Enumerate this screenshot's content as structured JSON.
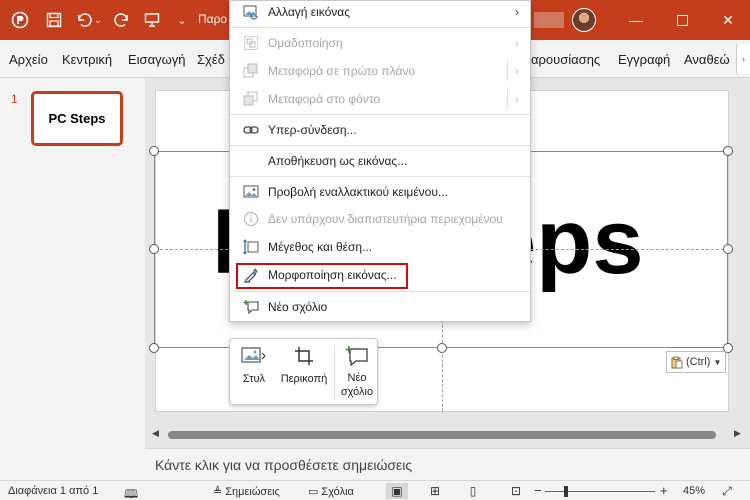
{
  "titlebar": {
    "doc_title": "Παρο",
    "colors": {
      "brand": "#c43e1c"
    },
    "icons": [
      "autosave-icon",
      "save-icon",
      "undo-icon",
      "redo-icon",
      "presentation-icon",
      "customize-icon"
    ],
    "window_controls": [
      "minimize-icon",
      "maximize-icon",
      "close-icon"
    ]
  },
  "menubar": {
    "tabs": [
      "Αρχείο",
      "Κεντρική",
      "Εισαγωγή",
      "Σχέδ",
      "αρουσίασης",
      "Εγγραφή",
      "Αναθεώ"
    ]
  },
  "slides_panel": {
    "slide_number": "1",
    "thumb_text": "PC Steps"
  },
  "slide": {
    "text_left": "P",
    "text_right": "eps",
    "paste_options": "(Ctrl)"
  },
  "context_menu": {
    "items": [
      {
        "label": "Αλλαγή εικόνας",
        "icon": "change-picture-icon",
        "submenu": true,
        "disabled": false
      },
      {
        "label": "Ομαδοποίηση",
        "icon": "group-icon",
        "submenu": true,
        "disabled": true
      },
      {
        "label": "Μεταφορά σε πρώτο πλάνο",
        "icon": "bring-forward-icon",
        "submenu": true,
        "disabled": true
      },
      {
        "label": "Μεταφορά στο φόντο",
        "icon": "send-backward-icon",
        "submenu": true,
        "disabled": true
      },
      {
        "label": "Υπερ-σύνδεση...",
        "icon": "link-icon",
        "submenu": false,
        "disabled": false
      },
      {
        "label": "Αποθήκευση ως εικόνας...",
        "icon": "",
        "submenu": false,
        "disabled": false
      },
      {
        "label": "Προβολή εναλλακτικού κειμένου...",
        "icon": "alt-text-icon",
        "submenu": false,
        "disabled": false
      },
      {
        "label": "Δεν υπάρχουν διαπιστευτήρια περιεχομένου",
        "icon": "content-credentials-icon",
        "submenu": false,
        "disabled": true
      },
      {
        "label": "Μέγεθος και θέση...",
        "icon": "size-position-icon",
        "submenu": false,
        "disabled": false
      },
      {
        "label": "Μορφοποίηση εικόνας...",
        "icon": "format-picture-icon",
        "submenu": false,
        "disabled": false
      },
      {
        "label": "Νέο σχόλιο",
        "icon": "new-comment-icon",
        "submenu": false,
        "disabled": false
      }
    ],
    "highlight_color": "#d10a0a"
  },
  "mini_toolbar": {
    "style_label": "Στυλ",
    "crop_label": "Περικοπή",
    "comment_label_1": "Νέο",
    "comment_label_2": "σχόλιο"
  },
  "notes": {
    "placeholder": "Κάντε κλικ για να προσθέσετε σημειώσεις"
  },
  "statusbar": {
    "slide_info": "Διαφάνεια 1 από 1",
    "notes_label": "Σημειώσεις",
    "comments_label": "Σχόλια",
    "zoom_level": "45%",
    "zoom_fraction": 0.45
  }
}
